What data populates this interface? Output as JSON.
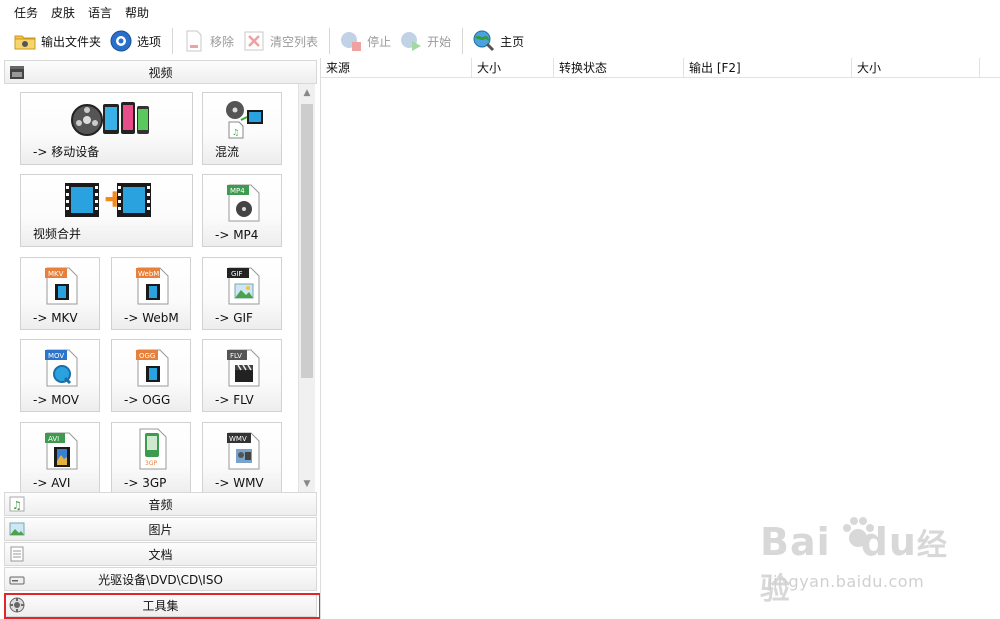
{
  "menu": [
    "任务",
    "皮肤",
    "语言",
    "帮助"
  ],
  "toolbar": {
    "output_folder": "输出文件夹",
    "options": "选项",
    "remove": "移除",
    "clear_list": "清空列表",
    "stop": "停止",
    "start": "开始",
    "home": "主页"
  },
  "categories": {
    "video": "视频",
    "audio": "音频",
    "image": "图片",
    "document": "文档",
    "disc": "光驱设备\\DVD\\CD\\ISO",
    "tools": "工具集"
  },
  "tiles": {
    "mobile": "-> 移动设备",
    "mux": "混流",
    "merge": "视频合并",
    "mp4": "-> MP4",
    "mkv": "-> MKV",
    "webm": "-> WebM",
    "gif": "-> GIF",
    "mov": "-> MOV",
    "ogg": "-> OGG",
    "flv": "-> FLV",
    "avi": "-> AVI",
    "3gp": "-> 3GP",
    "wmv": "-> WMV"
  },
  "badges": {
    "mp4": "MP4",
    "mkv": "MKV",
    "webm": "WebM",
    "gif": "GIF",
    "mov": "MOV",
    "ogg": "OGG",
    "flv": "FLV",
    "avi": "AVI",
    "wmv": "WMV",
    "3gp": "3GP"
  },
  "table": {
    "headers": [
      "来源",
      "大小",
      "转换状态",
      "输出 [F2]",
      "大小"
    ]
  },
  "watermark": {
    "logo": "Bai",
    "logo2": "du",
    "brand": "经验",
    "url": "jingyan.baidu.com"
  },
  "colors": {
    "highlight": "#e0262b",
    "accent_blue": "#2f7fd8"
  }
}
